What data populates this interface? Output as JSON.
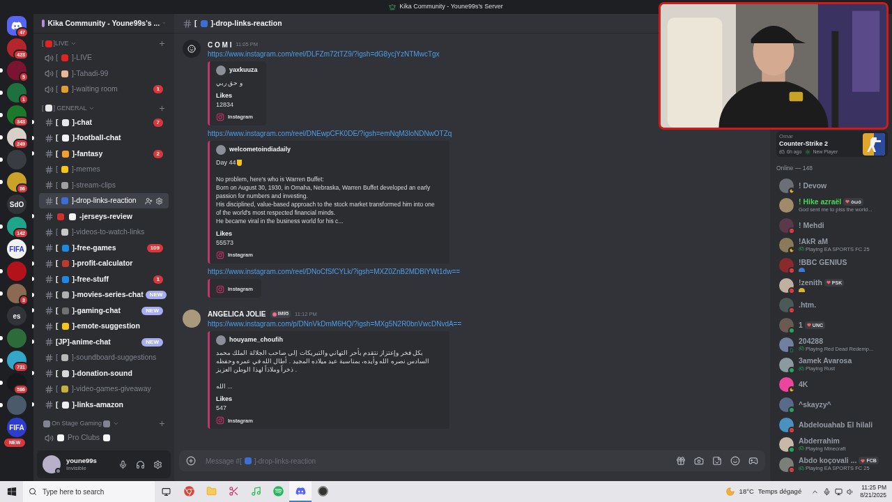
{
  "title_bar": {
    "title": "Kika Community - Youne99s's Server"
  },
  "servers": [
    {
      "kind": "home",
      "badge": {
        "kind": "count",
        "text": "47"
      },
      "unread": false,
      "color": "#5865f2"
    },
    {
      "kind": "picture",
      "badge": {
        "kind": "count",
        "text": "423"
      },
      "unread": false,
      "color": "#b3262b"
    },
    {
      "kind": "picture",
      "badge": {
        "kind": "count",
        "text": "5"
      },
      "unread": true,
      "color": "#7a1430"
    },
    {
      "kind": "picture",
      "badge": {
        "kind": "count",
        "text": "1"
      },
      "unread": true,
      "color": "#1f6f3f"
    },
    {
      "kind": "picture",
      "badge": {
        "kind": "count",
        "text": "343"
      },
      "unread": true,
      "color": "#1a7a2a"
    },
    {
      "kind": "picture",
      "badge": {
        "kind": "count",
        "text": "249"
      },
      "unread": true,
      "color": "#d6d0c8"
    },
    {
      "kind": "picture",
      "unread": true,
      "color": "#3a3c44"
    },
    {
      "kind": "picture",
      "badge": {
        "kind": "count",
        "text": "86"
      },
      "unread": true,
      "color": "#c9a227"
    },
    {
      "kind": "text",
      "label": "SdO",
      "unread": false,
      "color": "#313338"
    },
    {
      "kind": "picture",
      "badge": {
        "kind": "count",
        "text": "142"
      },
      "unread": true,
      "color": "#1fa58a"
    },
    {
      "kind": "text",
      "label": "FIFA",
      "unread": false,
      "color": "#f2f2f2"
    },
    {
      "kind": "picture",
      "unread": true,
      "color": "#b3121b"
    },
    {
      "kind": "picture",
      "badge": {
        "kind": "count",
        "text": "3"
      },
      "unread": true,
      "color": "#8a6a50"
    },
    {
      "kind": "text",
      "label": "es",
      "unread": false,
      "color": "#313338"
    },
    {
      "kind": "picture",
      "unread": true,
      "color": "#2d6b3a"
    },
    {
      "kind": "picture",
      "badge": {
        "kind": "count",
        "text": "731"
      },
      "unread": true,
      "color": "#34a7c9"
    },
    {
      "kind": "picture",
      "badge": {
        "kind": "count",
        "text": "586"
      },
      "unread": true,
      "color": "#16181a"
    },
    {
      "kind": "picture",
      "unread": true,
      "color": "#4a5a6a"
    },
    {
      "kind": "text",
      "label": "FIFA",
      "badge": {
        "kind": "new",
        "text": "NEW"
      },
      "unread": false,
      "color": "#2e3bd0"
    }
  ],
  "server_header": {
    "name": "Kika Community - Youne99s's ..."
  },
  "sections": [
    {
      "kind": "category",
      "pre": "[",
      "emojis": [
        {
          "color": "#e02424"
        }
      ],
      "post": "]LIVE",
      "channels": [
        {
          "kind": "voice",
          "pre": "[",
          "emojis": [
            {
              "color": "#e02424"
            }
          ],
          "post": "]-LIVE",
          "unread": false,
          "selected": false
        },
        {
          "kind": "voice",
          "pre": "[",
          "emojis": [
            {
              "color": "#e8b896"
            }
          ],
          "post": "]-Tahadi-99",
          "unread": false,
          "selected": false
        },
        {
          "kind": "voice",
          "pre": "[",
          "emojis": [
            {
              "color": "#e0a030"
            }
          ],
          "post": "]-waiting room",
          "unread": false,
          "selected": false,
          "badge": {
            "kind": "count",
            "text": "1"
          }
        }
      ]
    },
    {
      "kind": "category",
      "pre": "[",
      "emojis": [
        {
          "color": "#e8e8e8"
        }
      ],
      "post": "] GENERAL",
      "channels": [
        {
          "kind": "text",
          "pre": "[",
          "emojis": [
            {
              "color": "#e8e8e8"
            }
          ],
          "post": "]-chat",
          "unread": true,
          "selected": false,
          "badge": {
            "kind": "count",
            "text": "7"
          }
        },
        {
          "kind": "text",
          "pre": "[",
          "emojis": [
            {
              "color": "#f5f5f5"
            }
          ],
          "post": "]-football-chat",
          "unread": true,
          "selected": false
        },
        {
          "kind": "text",
          "pre": "[",
          "emojis": [
            {
              "color": "#f0a030"
            }
          ],
          "post": "]-fantasy",
          "unread": true,
          "selected": false,
          "badge": {
            "kind": "count",
            "text": "2"
          }
        },
        {
          "kind": "text",
          "pre": "[",
          "emojis": [
            {
              "color": "#f5c518"
            }
          ],
          "post": "]-memes",
          "unread": false,
          "selected": false
        },
        {
          "kind": "text",
          "pre": "[",
          "emojis": [
            {
              "color": "#a0a0a0"
            }
          ],
          "post": "]-stream-clips",
          "unread": false,
          "selected": false
        },
        {
          "kind": "text",
          "pre": "[",
          "emojis": [
            {
              "color": "#3b6fd4"
            }
          ],
          "post": "]-drop-links-reaction",
          "unread": false,
          "selected": true
        },
        {
          "kind": "text",
          "emojis": [
            {
              "color": "#d32f2f"
            },
            {
              "color": "#f5f5f5"
            }
          ],
          "post": "-jerseys-review",
          "unread": true,
          "selected": false
        },
        {
          "kind": "text",
          "pre": "[",
          "emojis": [
            {
              "color": "#c8c8c8"
            }
          ],
          "post": "]-videos-to-watch-links",
          "unread": false,
          "selected": false
        },
        {
          "kind": "text",
          "pre": "[",
          "emojis": [
            {
              "color": "#1e88e5"
            }
          ],
          "post": "]-free-games",
          "unread": true,
          "selected": false,
          "badge": {
            "kind": "count",
            "text": "109"
          }
        },
        {
          "kind": "text",
          "pre": "[",
          "emojis": [
            {
              "color": "#c0392b"
            }
          ],
          "post": "]-profit-calculator",
          "unread": true,
          "selected": false
        },
        {
          "kind": "text",
          "pre": "[",
          "emojis": [
            {
              "color": "#1e88e5"
            }
          ],
          "post": "]-free-stuff",
          "unread": true,
          "selected": false,
          "badge": {
            "kind": "count",
            "text": "1"
          }
        },
        {
          "kind": "text",
          "pre": "[",
          "emojis": [
            {
              "color": "#b0b0b0"
            }
          ],
          "post": "]-movies-series-chat",
          "unread": true,
          "selected": false,
          "badge": {
            "kind": "new",
            "text": "NEW"
          }
        },
        {
          "kind": "text",
          "pre": "[",
          "emojis": [
            {
              "color": "#707070"
            }
          ],
          "post": "]-gaming-chat",
          "unread": true,
          "selected": false,
          "badge": {
            "kind": "new",
            "text": "NEW"
          }
        },
        {
          "kind": "text",
          "pre": "[",
          "emojis": [
            {
              "color": "#f5c518"
            }
          ],
          "post": "]-emote-suggestion",
          "unread": true,
          "selected": false
        },
        {
          "kind": "text",
          "post": "[JP]-anime-chat",
          "unread": true,
          "selected": false,
          "badge": {
            "kind": "new",
            "text": "NEW"
          }
        },
        {
          "kind": "text",
          "pre": "[",
          "emojis": [
            {
              "color": "#b8b8b8"
            }
          ],
          "post": "]-soundboard-suggestions",
          "unread": false,
          "selected": false
        },
        {
          "kind": "text",
          "pre": "[",
          "emojis": [
            {
              "color": "#d8d8d8"
            }
          ],
          "post": "]-donation-sound",
          "unread": true,
          "selected": false
        },
        {
          "kind": "text",
          "pre": "[",
          "emojis": [
            {
              "color": "#c8b040"
            }
          ],
          "post": "]-video-games-giveaway",
          "unread": false,
          "selected": false
        },
        {
          "kind": "text",
          "pre": "[",
          "emojis": [
            {
              "color": "#eeeeee"
            }
          ],
          "post": "]-links-amazon",
          "unread": true,
          "selected": false
        }
      ]
    },
    {
      "kind": "category",
      "emojis": [
        {
          "color": "#80848e"
        }
      ],
      "post": "On Stage Gaming",
      "emojis_after": [
        {
          "color": "#80848e"
        }
      ],
      "channels": [
        {
          "kind": "voice",
          "emojis": [
            {
              "color": "#f5f5f5"
            }
          ],
          "post": "Pro Clubs",
          "emojis_after": [
            {
              "color": "#f5f5f5"
            }
          ],
          "unread": false,
          "selected": false
        }
      ]
    }
  ],
  "user_panel": {
    "name": "youne99s",
    "status": "Invisible"
  },
  "chat_header": {
    "pre": "[",
    "emojis": [
      {
        "color": "#3b6fd4"
      }
    ],
    "post": "]-drop-links-reaction"
  },
  "messages": [
    {
      "author": "C O M I",
      "time": "11:05 PM",
      "blocks": [
        {
          "link": "https://www.instagram.com/reel/DLFZm72tTZ9/?igsh=dG8ycjYzNTMwcTgx",
          "embed": {
            "author": "yaxkuuza",
            "lines": [
              "و حق ربي"
            ],
            "likes_label": "Likes",
            "likes": "12834",
            "footer": "Instagram"
          }
        },
        {
          "link": "https://www.instagram.com/reel/DNEwpCFK0DE/?igsh=emNqM3loNDNwOTZq",
          "embed": {
            "author": "welcometoindiadaily",
            "lead": "Day 44",
            "lead_emoji": {
              "color": "#f5c518"
            },
            "lines": [
              "No problem, here's who is Warren Buffet:",
              "Born on August 30, 1930, in Omaha, Nebraska, Warren Buffet developed an early passion for numbers and investing.",
              "His disciplined, value-based approach to the stock market transformed him into one of the world's most respected financial minds.",
              "He became viral in the business world for his c..."
            ],
            "likes_label": "Likes",
            "likes": "55573",
            "footer": "Instagram"
          }
        },
        {
          "link": "https://www.instagram.com/reel/DNoCfSfCYLk/?igsh=MXZ0ZnB2MDBlYWt1dw==",
          "embed": {
            "footer": "Instagram"
          }
        }
      ]
    },
    {
      "author": "ANGELICA JOLIE",
      "tag": "IM95",
      "time": "11:12 PM",
      "blocks": [
        {
          "link": "https://www.instagram.com/p/DNnVkDmM6HQ/?igsh=MXg5N2R0bnVwcDNvdA==",
          "embed": {
            "author": "houyame_choufih",
            "lines": [
              "بكل فخر وإعتزاز نتقدم بأحر التهاني والتبريكات إلى صاحب الجلالة الملك محمد السادس نصره الله وأيده، بمناسبة عيد ميلاده المجيد . أطال الله في عمره وحفظه ذخراً وملاذاً لهذا الوطن العزيز ."
            ],
            "tail": "الله ...",
            "likes_label": "Likes",
            "likes": "547",
            "footer": "Instagram"
          }
        }
      ]
    }
  ],
  "composer": {
    "pre": "Message #[",
    "emojis": [
      {
        "color": "#3b6fd4"
      }
    ],
    "post": "]-drop-links-reaction"
  },
  "activity_card": {
    "user": "Omar",
    "game": "Counter-Strike 2",
    "ago": "6h ago",
    "badge": "New Player"
  },
  "members_heading": "Online — 148",
  "members": [
    {
      "name": "! Devow",
      "presence": {
        "kind": "idle"
      },
      "color": "#949ba4"
    },
    {
      "name": "! Hike azraël",
      "color": "#43d854",
      "tag": "òωó",
      "subtitle": "God sent me to piss the world..."
    },
    {
      "name": "! Mehdi",
      "presence": {
        "kind": "dnd"
      },
      "color": "#949ba4"
    },
    {
      "name": "!AkR aM",
      "presence": {
        "kind": "idle"
      },
      "color": "#949ba4",
      "activity": "Playing EA SPORTS FC 25"
    },
    {
      "name": "!BBC GENIUS",
      "presence": {
        "kind": "dnd"
      },
      "color": "#949ba4",
      "status_emoji": {
        "color": "#3b7dd8"
      }
    },
    {
      "name": "!zenith",
      "presence": {
        "kind": "dnd"
      },
      "color": "#949ba4",
      "tag": "PSK",
      "status_emoji": {
        "color": "#e0b030"
      }
    },
    {
      "name": ".htm.",
      "presence": {
        "kind": "dnd"
      },
      "color": "#949ba4"
    },
    {
      "name": "1",
      "presence": {
        "kind": "online"
      },
      "color": "#949ba4",
      "tag": "UNC"
    },
    {
      "name": "204288",
      "presence": {
        "kind": "mobile"
      },
      "color": "#949ba4",
      "activity": "Playing Red Dead Redemp..."
    },
    {
      "name": "3amek Avarosa",
      "presence": {
        "kind": "online"
      },
      "color": "#949ba4",
      "activity": "Playing Rust"
    },
    {
      "name": "4K",
      "presence": {
        "kind": "idle"
      },
      "color": "#949ba4"
    },
    {
      "name": "^skayzy^",
      "presence": {
        "kind": "online"
      },
      "color": "#949ba4"
    },
    {
      "name": "Abdelouahab El hilali",
      "presence": {
        "kind": "dnd"
      },
      "color": "#949ba4"
    },
    {
      "name": "Abderrahim",
      "presence": {
        "kind": "online"
      },
      "color": "#949ba4",
      "activity": "Playing Minecraft"
    },
    {
      "name": "Abdo koçovali ...",
      "presence": {
        "kind": "dnd"
      },
      "color": "#949ba4",
      "tag": "FCB",
      "activity": "Playing EA SPORTS FC 25"
    }
  ],
  "taskbar": {
    "search_placeholder": "Type here to search",
    "apps": [
      {
        "kind": "browser",
        "selected": false
      },
      {
        "kind": "folder",
        "selected": false
      },
      {
        "kind": "snip",
        "selected": false
      },
      {
        "kind": "music",
        "selected": false
      },
      {
        "kind": "spotify",
        "selected": false
      },
      {
        "kind": "discord",
        "selected": true
      },
      {
        "kind": "recorder",
        "selected": false
      }
    ],
    "temperature": "18°C",
    "weather": "Temps dégagé",
    "time": "11:25 PM",
    "date": "8/21/2025"
  }
}
